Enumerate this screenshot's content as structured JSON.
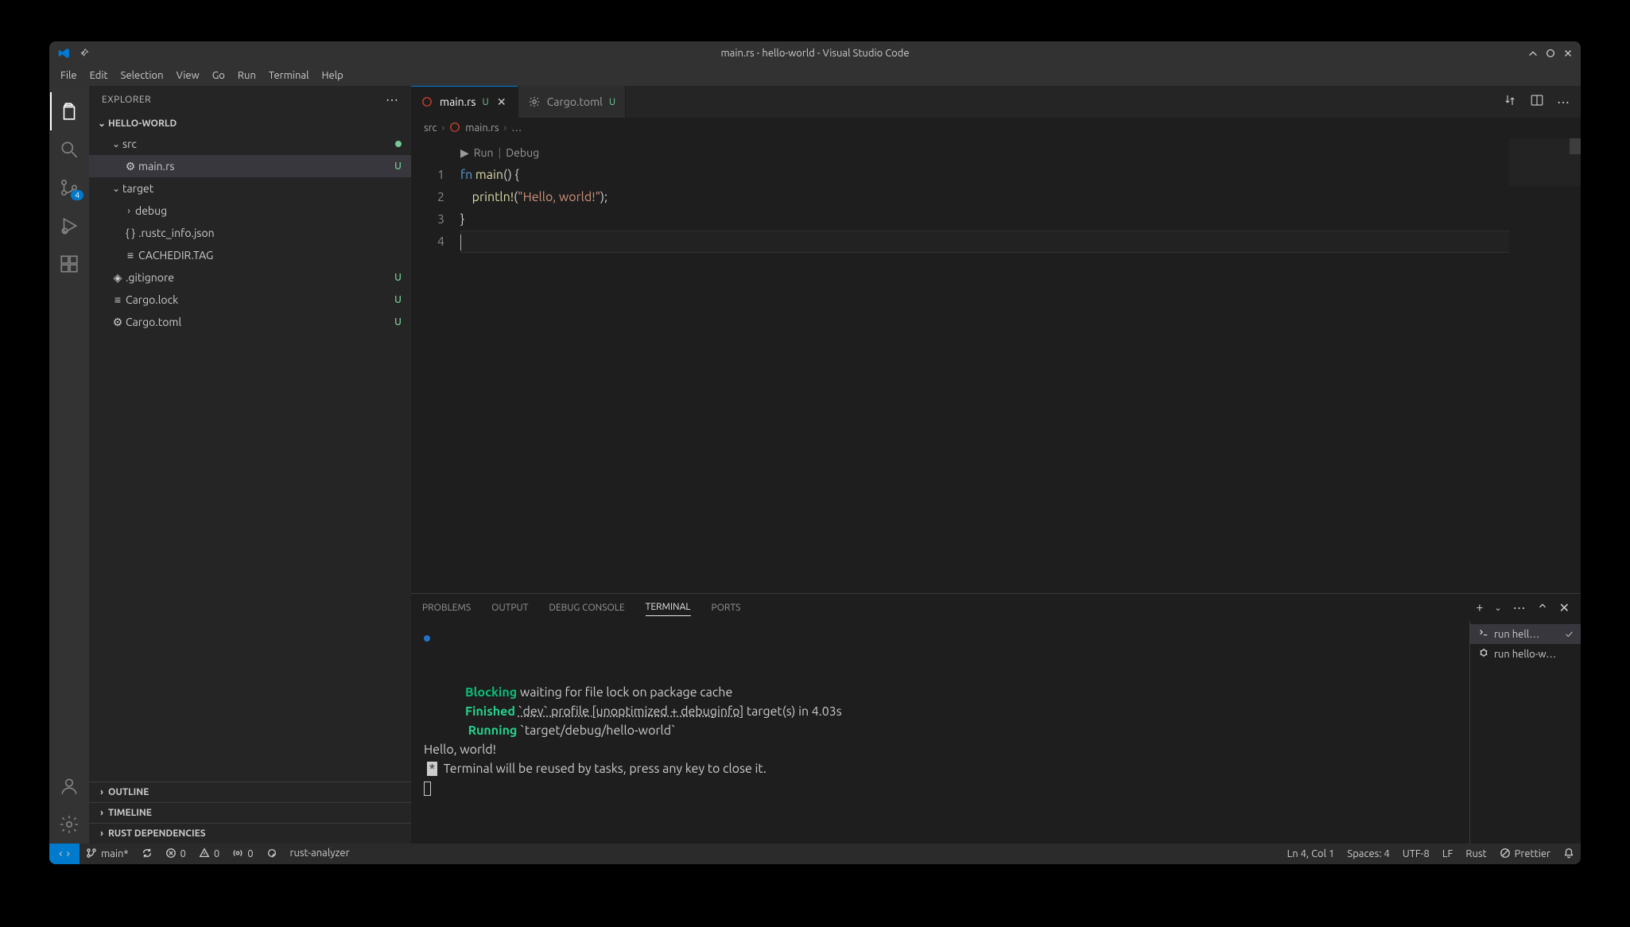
{
  "window": {
    "title": "main.rs - hello-world - Visual Studio Code"
  },
  "menu": [
    "File",
    "Edit",
    "Selection",
    "View",
    "Go",
    "Run",
    "Terminal",
    "Help"
  ],
  "activity": [
    {
      "name": "explorer-icon",
      "active": true
    },
    {
      "name": "search-icon"
    },
    {
      "name": "scm-icon",
      "badge": "4"
    },
    {
      "name": "run-debug-icon"
    },
    {
      "name": "extensions-icon"
    }
  ],
  "activity_bottom": [
    {
      "name": "account-icon"
    },
    {
      "name": "settings-gear-icon"
    }
  ],
  "sidebar": {
    "title": "EXPLORER",
    "root_label": "HELLO-WORLD",
    "tree": [
      {
        "indent": 1,
        "kind": "folder-open",
        "label": "src",
        "dot": true
      },
      {
        "indent": 2,
        "kind": "rust",
        "label": "main.rs",
        "status": "U",
        "selected": true
      },
      {
        "indent": 1,
        "kind": "folder-open",
        "label": "target"
      },
      {
        "indent": 2,
        "kind": "folder-closed",
        "label": "debug"
      },
      {
        "indent": 2,
        "kind": "json",
        "label": ".rustc_info.json"
      },
      {
        "indent": 2,
        "kind": "file",
        "label": "CACHEDIR.TAG"
      },
      {
        "indent": 1,
        "kind": "git",
        "label": ".gitignore",
        "status": "U"
      },
      {
        "indent": 1,
        "kind": "file",
        "label": "Cargo.lock",
        "status": "U"
      },
      {
        "indent": 1,
        "kind": "gear",
        "label": "Cargo.toml",
        "status": "U"
      }
    ],
    "collapsed_sections": [
      "OUTLINE",
      "TIMELINE",
      "RUST DEPENDENCIES"
    ]
  },
  "tabs": [
    {
      "icon": "rust",
      "label": "main.rs",
      "status": "U",
      "active": true,
      "closable": true
    },
    {
      "icon": "gear",
      "label": "Cargo.toml",
      "status": "U",
      "active": false
    }
  ],
  "breadcrumb": {
    "path": [
      "src",
      "main.rs",
      "…"
    ],
    "icons": [
      "",
      "rust",
      ""
    ]
  },
  "codelens": {
    "run": "Run",
    "debug": "Debug"
  },
  "code": {
    "lines": [
      {
        "n": "1",
        "html": "<span class='tok-kw'>fn</span> <span class='tok-fn'>main</span><span class='tok-pn'>() {</span>"
      },
      {
        "n": "2",
        "html": "    <span class='tok-mac'>println!</span><span class='tok-pn'>(</span><span class='tok-str'>\"Hello, world!\"</span><span class='tok-pn'>);</span>"
      },
      {
        "n": "3",
        "html": "<span class='tok-pn'>}</span>"
      },
      {
        "n": "4",
        "html": "<span class='cursor-caret'></span>"
      }
    ]
  },
  "panel": {
    "tabs": [
      "PROBLEMS",
      "OUTPUT",
      "DEBUG CONSOLE",
      "TERMINAL",
      "PORTS"
    ],
    "active_tab": "TERMINAL",
    "terminal": {
      "lines": [
        {
          "cls": "",
          "html": "<span class='term-indent'></span><span class='term-green'>Blocking</span> waiting for file lock on package cache"
        },
        {
          "cls": "",
          "html": "<span class='term-indent'></span><span class='term-greenb'>Finished</span> <span class='term-link'>`dev` profile [unoptimized + debuginfo]</span> target(s) in 4.03s"
        },
        {
          "cls": "",
          "html": "<span class='term-indent'></span> <span class='term-greenb'>Running</span> `target/debug/hello-world`"
        },
        {
          "cls": "",
          "html": "Hello, world!"
        },
        {
          "cls": "",
          "html": " <span class='term-invert'>*</span>  Terminal will be reused by tasks, press any key to close it."
        },
        {
          "cls": "",
          "html": "<span class='term-cursor-block'></span>"
        }
      ],
      "side": [
        {
          "icon": "task",
          "label": "run hell…",
          "check": true,
          "active": true
        },
        {
          "icon": "bug",
          "label": "run hello-w…"
        }
      ]
    }
  },
  "status": {
    "left": [
      {
        "icon": "branch",
        "text": "main*"
      },
      {
        "icon": "sync",
        "text": ""
      },
      {
        "icon": "error",
        "text": "0"
      },
      {
        "icon": "warning",
        "text": "0"
      },
      {
        "icon": "radio",
        "text": "0"
      },
      {
        "icon": "target",
        "text": ""
      },
      {
        "icon": "",
        "text": "rust-analyzer"
      }
    ],
    "right": [
      {
        "text": "Ln 4, Col 1"
      },
      {
        "text": "Spaces: 4"
      },
      {
        "text": "UTF-8"
      },
      {
        "text": "LF"
      },
      {
        "text": "Rust"
      },
      {
        "icon": "noformat",
        "text": "Prettier"
      },
      {
        "icon": "bell",
        "text": ""
      }
    ]
  }
}
